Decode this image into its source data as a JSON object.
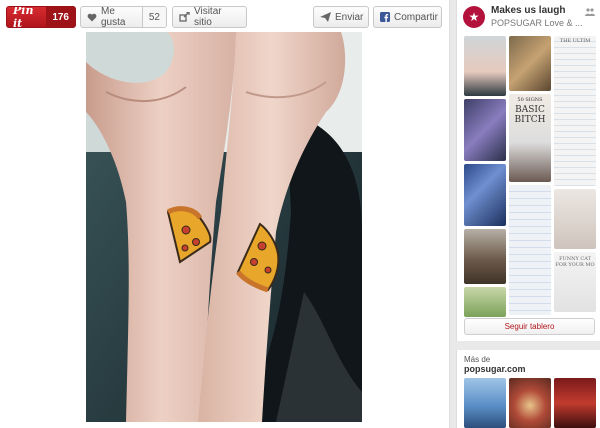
{
  "actions": {
    "pin_label": "Pin it",
    "pin_count": "176",
    "like_label": "Me gusta",
    "like_count": "52",
    "visit_label": "Visitar sitio",
    "send_label": "Enviar",
    "share_label": "Compartir"
  },
  "board": {
    "title": "Makes us laugh",
    "owner": "POPSUGAR Love & ...",
    "follow_label": "Seguir tablero",
    "thumb_texts": {
      "basic_top": "50 SIGNS",
      "basic_main": "BASIC BITCH",
      "list_header": "THE ULTIM",
      "funny_caption": "FUNNY CAT FOR YOUR MO"
    }
  },
  "more_from": {
    "label": "Más de",
    "site": "popsugar.com"
  },
  "colors": {
    "pin_red": "#c8232c",
    "accent_red": "#b0161c"
  },
  "icons": {
    "heart": "heart-icon",
    "visit": "arrow-out-icon",
    "send": "send-icon",
    "share": "facebook-icon",
    "avatar": "star-icon",
    "people": "people-icon"
  }
}
